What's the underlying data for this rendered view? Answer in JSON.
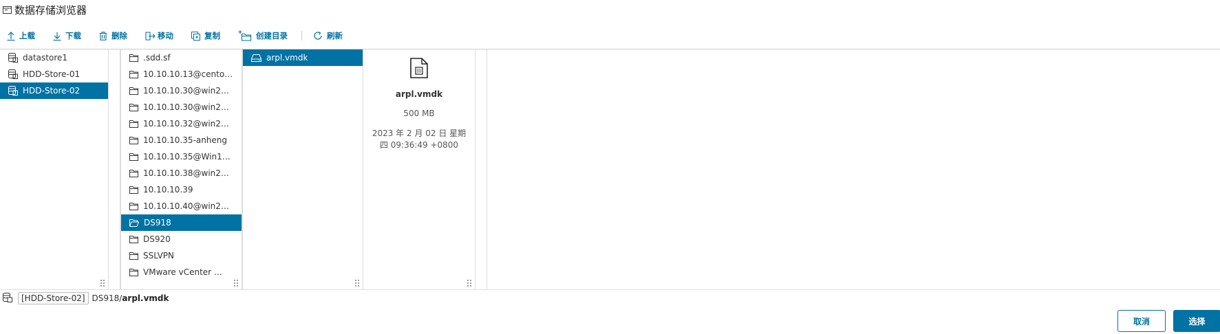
{
  "window": {
    "title": "数据存储浏览器"
  },
  "toolbar": {
    "upload": "上载",
    "download": "下载",
    "delete": "删除",
    "move": "移动",
    "copy": "复制",
    "mkdir": "创建目录",
    "refresh": "刷新"
  },
  "datastores": [
    {
      "label": "datastore1",
      "selected": false
    },
    {
      "label": "HDD-Store-01",
      "selected": false
    },
    {
      "label": "HDD-Store-02",
      "selected": true
    }
  ],
  "folders": [
    {
      "label": ".sdd.sf",
      "selected": false
    },
    {
      "label": "10.10.10.13@cento…",
      "selected": false
    },
    {
      "label": "10.10.10.30@win2…",
      "selected": false
    },
    {
      "label": "10.10.10.30@win2…",
      "selected": false
    },
    {
      "label": "10.10.10.32@win2…",
      "selected": false
    },
    {
      "label": "10.10.10.35-anheng",
      "selected": false
    },
    {
      "label": "10.10.10.35@Win1…",
      "selected": false
    },
    {
      "label": "10.10.10.38@win2…",
      "selected": false
    },
    {
      "label": "10.10.10.39",
      "selected": false
    },
    {
      "label": "10.10.10.40@win2…",
      "selected": false
    },
    {
      "label": "DS918",
      "selected": true
    },
    {
      "label": "DS920",
      "selected": false
    },
    {
      "label": "SSLVPN",
      "selected": false
    },
    {
      "label": "VMware vCenter …",
      "selected": false
    }
  ],
  "files": [
    {
      "label": "arpl.vmdk",
      "selected": true
    }
  ],
  "details": {
    "name": "arpl.vmdk",
    "size": "500 MB",
    "date": "2023 年 2 月 02 日 星期四 09:36:49 +0800"
  },
  "pathbar": {
    "datastore": "[HDD-Store-02]",
    "dir": "DS918/",
    "file": "arpl.vmdk"
  },
  "buttons": {
    "cancel": "取消",
    "ok": "选择"
  },
  "colors": {
    "accent": "#0072a3"
  }
}
